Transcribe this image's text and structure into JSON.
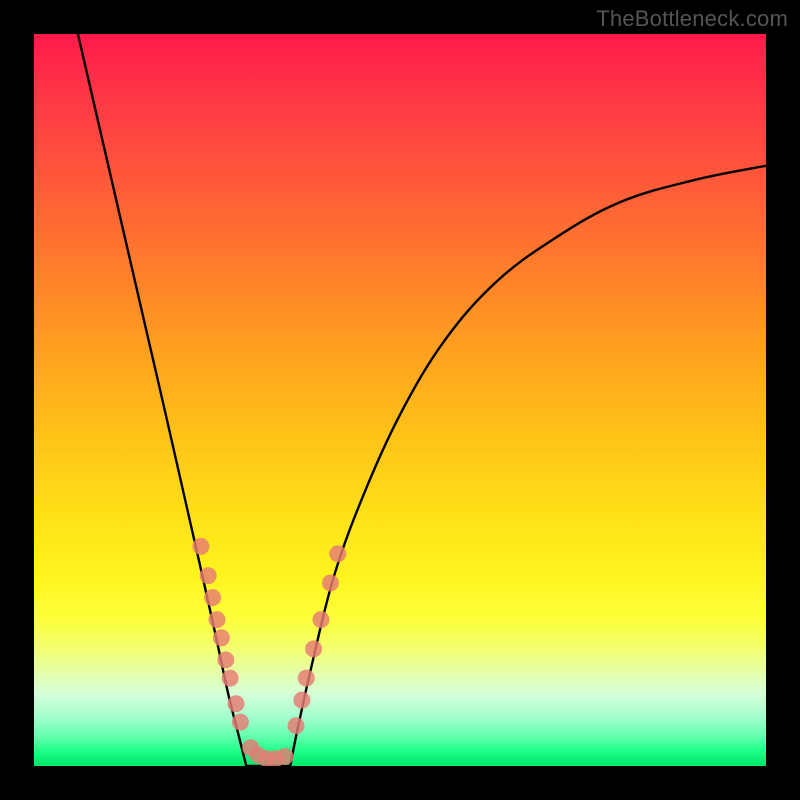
{
  "watermark": "TheBottleneck.com",
  "colors": {
    "frame": "#000000",
    "curve": "#000000",
    "dot": "#e77b74"
  },
  "chart_data": {
    "type": "line",
    "title": "",
    "xlabel": "",
    "ylabel": "",
    "xlim": [
      0,
      1
    ],
    "ylim": [
      0,
      1
    ],
    "series": [
      {
        "name": "left-curve",
        "x": [
          0.06,
          0.09,
          0.12,
          0.15,
          0.18,
          0.205,
          0.23,
          0.25,
          0.265,
          0.28,
          0.29
        ],
        "y": [
          1.0,
          0.87,
          0.74,
          0.61,
          0.48,
          0.37,
          0.26,
          0.17,
          0.1,
          0.04,
          0.0
        ]
      },
      {
        "name": "valley-floor",
        "x": [
          0.29,
          0.3,
          0.312,
          0.325,
          0.338,
          0.35
        ],
        "y": [
          0.0,
          0.0,
          0.0,
          0.0,
          0.0,
          0.0
        ]
      },
      {
        "name": "right-curve",
        "x": [
          0.35,
          0.36,
          0.38,
          0.41,
          0.45,
          0.5,
          0.56,
          0.63,
          0.71,
          0.8,
          0.9,
          1.0
        ],
        "y": [
          0.0,
          0.05,
          0.14,
          0.26,
          0.37,
          0.48,
          0.58,
          0.66,
          0.72,
          0.77,
          0.8,
          0.82
        ]
      }
    ],
    "scatter": [
      {
        "name": "left-band",
        "points": [
          [
            0.228,
            0.3
          ],
          [
            0.238,
            0.26
          ],
          [
            0.244,
            0.23
          ],
          [
            0.25,
            0.2
          ],
          [
            0.256,
            0.175
          ],
          [
            0.262,
            0.145
          ],
          [
            0.268,
            0.12
          ],
          [
            0.276,
            0.085
          ],
          [
            0.282,
            0.06
          ]
        ]
      },
      {
        "name": "valley-band",
        "points": [
          [
            0.296,
            0.025
          ],
          [
            0.306,
            0.015
          ],
          [
            0.318,
            0.01
          ],
          [
            0.33,
            0.01
          ],
          [
            0.343,
            0.013
          ]
        ]
      },
      {
        "name": "right-band",
        "points": [
          [
            0.358,
            0.055
          ],
          [
            0.366,
            0.09
          ],
          [
            0.372,
            0.12
          ],
          [
            0.382,
            0.16
          ],
          [
            0.392,
            0.2
          ],
          [
            0.405,
            0.25
          ],
          [
            0.415,
            0.29
          ]
        ]
      }
    ],
    "gradient_stops": [
      {
        "pos": 0.0,
        "color": "#ff1a4b"
      },
      {
        "pos": 0.74,
        "color": "#fff41e"
      },
      {
        "pos": 1.0,
        "color": "#00e765"
      }
    ]
  }
}
